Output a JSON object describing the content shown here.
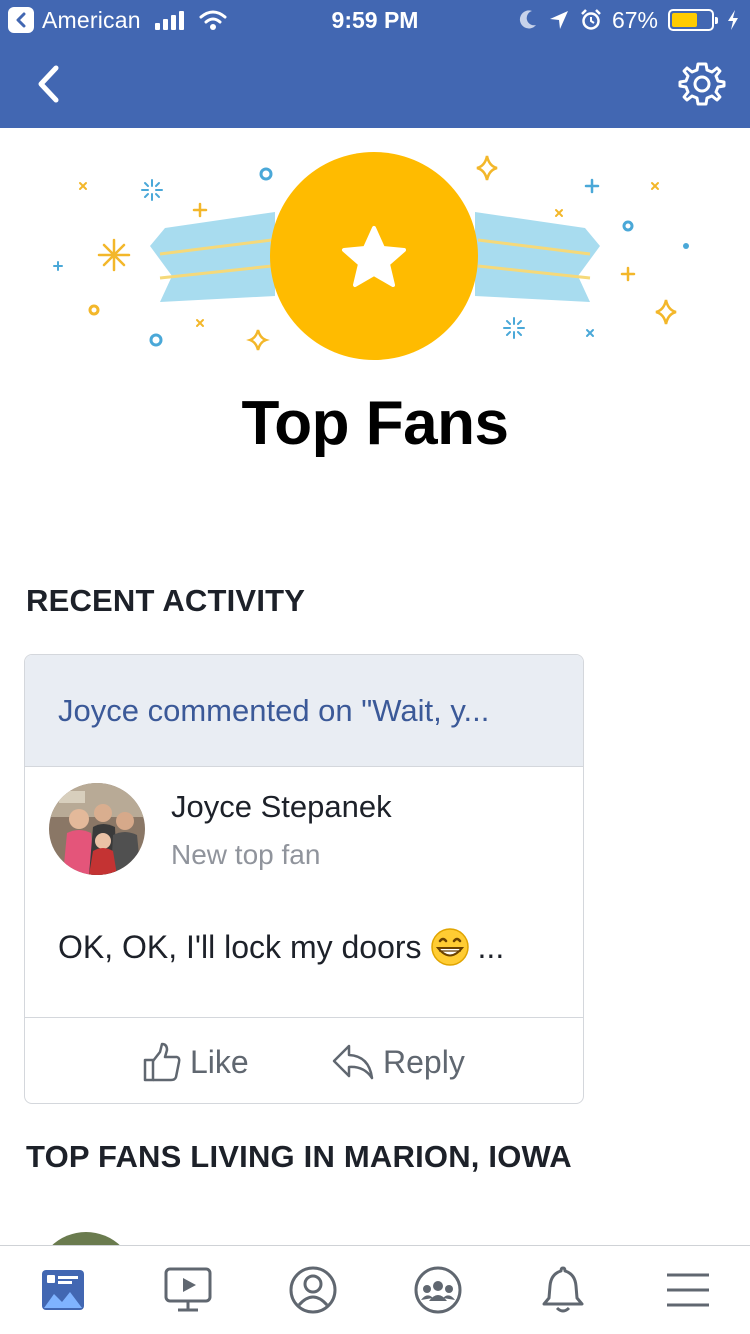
{
  "status_bar": {
    "carrier": "American",
    "time": "9:59 PM",
    "battery_percent": "67%",
    "battery_level": 0.67,
    "icons": [
      "back-to-app-icon",
      "signal-icon",
      "wifi-icon",
      "moon-icon",
      "location-arrow-icon",
      "alarm-icon",
      "battery-icon",
      "charging-bolt-icon"
    ]
  },
  "nav": {
    "back_icon": "chevron-left-icon",
    "settings_icon": "gear-icon"
  },
  "page": {
    "title": "Top Fans"
  },
  "recent_activity": {
    "heading": "RECENT ACTIVITY",
    "card": {
      "header": "Joyce commented on \"Wait, y...",
      "fan_name": "Joyce Stepanek",
      "fan_subtitle": "New top fan",
      "comment": "OK, OK, I'll lock my doors",
      "comment_suffix": "...",
      "like_label": "Like",
      "reply_label": "Reply"
    }
  },
  "top_fans_local": {
    "heading": "TOP FANS LIVING IN MARION, IOWA"
  },
  "tab_bar": {
    "tabs": [
      {
        "icon": "news-feed-icon",
        "active": true
      },
      {
        "icon": "watch-video-icon",
        "active": false
      },
      {
        "icon": "profile-icon",
        "active": false
      },
      {
        "icon": "groups-icon",
        "active": false
      },
      {
        "icon": "notifications-bell-icon",
        "active": false
      },
      {
        "icon": "menu-icon",
        "active": false
      }
    ]
  },
  "colors": {
    "brand_blue": "#4267b2",
    "link_blue": "#3b5998",
    "medal_gold": "#ffbb00",
    "ribbon_blue": "#a8dcef",
    "header_gray": "#e9edf3"
  }
}
